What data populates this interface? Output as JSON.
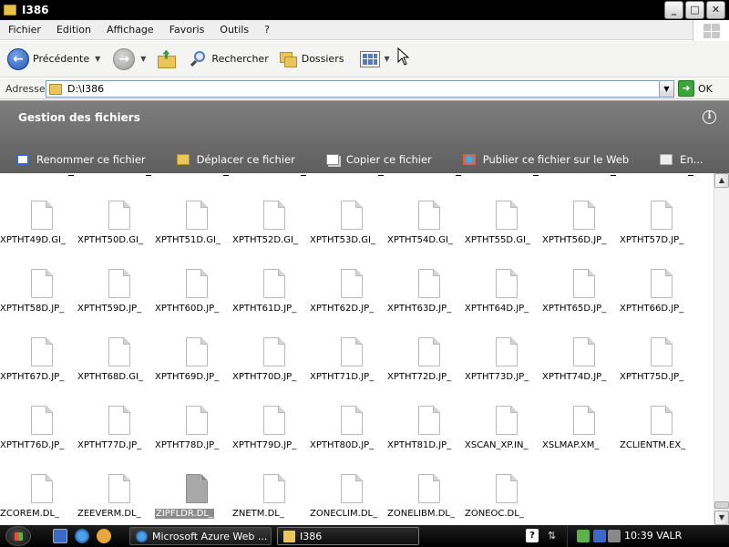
{
  "window": {
    "title": "I386"
  },
  "menu": [
    "Fichier",
    "Edition",
    "Affichage",
    "Favoris",
    "Outils",
    "?"
  ],
  "toolbar": {
    "back_label": "Précédente",
    "search_label": "Rechercher",
    "folders_label": "Dossiers"
  },
  "address": {
    "label": "Adresse",
    "value": "D:\\I386",
    "go_label": "OK"
  },
  "task_panel": {
    "title": "Gestion des fichiers",
    "info_icon": "i",
    "actions": [
      "Renommer ce fichier",
      "Déplacer ce fichier",
      "Copier ce fichier",
      "Publier ce fichier sur le Web",
      "En..."
    ]
  },
  "files": [
    [
      "XPTHT49D.GI_",
      "XPTHT50D.GI_",
      "XPTHT51D.GI_",
      "XPTHT52D.GI_",
      "XPTHT53D.GI_",
      "XPTHT54D.GI_",
      "XPTHT55D.GI_",
      "XPTHT56D.JP_",
      "XPTHT57D.JP_"
    ],
    [
      "XPTHT58D.JP_",
      "XPTHT59D.JP_",
      "XPTHT60D.JP_",
      "XPTHT61D.JP_",
      "XPTHT62D.JP_",
      "XPTHT63D.JP_",
      "XPTHT64D.JP_",
      "XPTHT65D.JP_",
      "XPTHT66D.JP_"
    ],
    [
      "XPTHT67D.JP_",
      "XPTHT68D.GI_",
      "XPTHT69D.JP_",
      "XPTHT70D.JP_",
      "XPTHT71D.JP_",
      "XPTHT72D.JP_",
      "XPTHT73D.JP_",
      "XPTHT74D.JP_",
      "XPTHT75D.JP_"
    ],
    [
      "XPTHT76D.JP_",
      "XPTHT77D.JP_",
      "XPTHT78D.JP_",
      "XPTHT79D.JP_",
      "XPTHT80D.JP_",
      "XPTHT81D.JP_",
      "XSCAN_XP.IN_",
      "XSLMAP.XM_",
      "ZCLIENTM.EX_"
    ],
    [
      "ZCOREM.DL_",
      "ZEEVERM.DL_",
      "ZIPFLDR.DL_",
      "ZNETM.DL_",
      "ZONECLIM.DL_",
      "ZONELIBM.DL_",
      "ZONEOC.DL_"
    ]
  ],
  "selected_file": "ZIPFLDR.DL_",
  "taskbar": {
    "tasks": [
      "Microsoft Azure Web ...",
      "I386"
    ],
    "help_icon": "?",
    "clock": "10:39 VALR"
  }
}
